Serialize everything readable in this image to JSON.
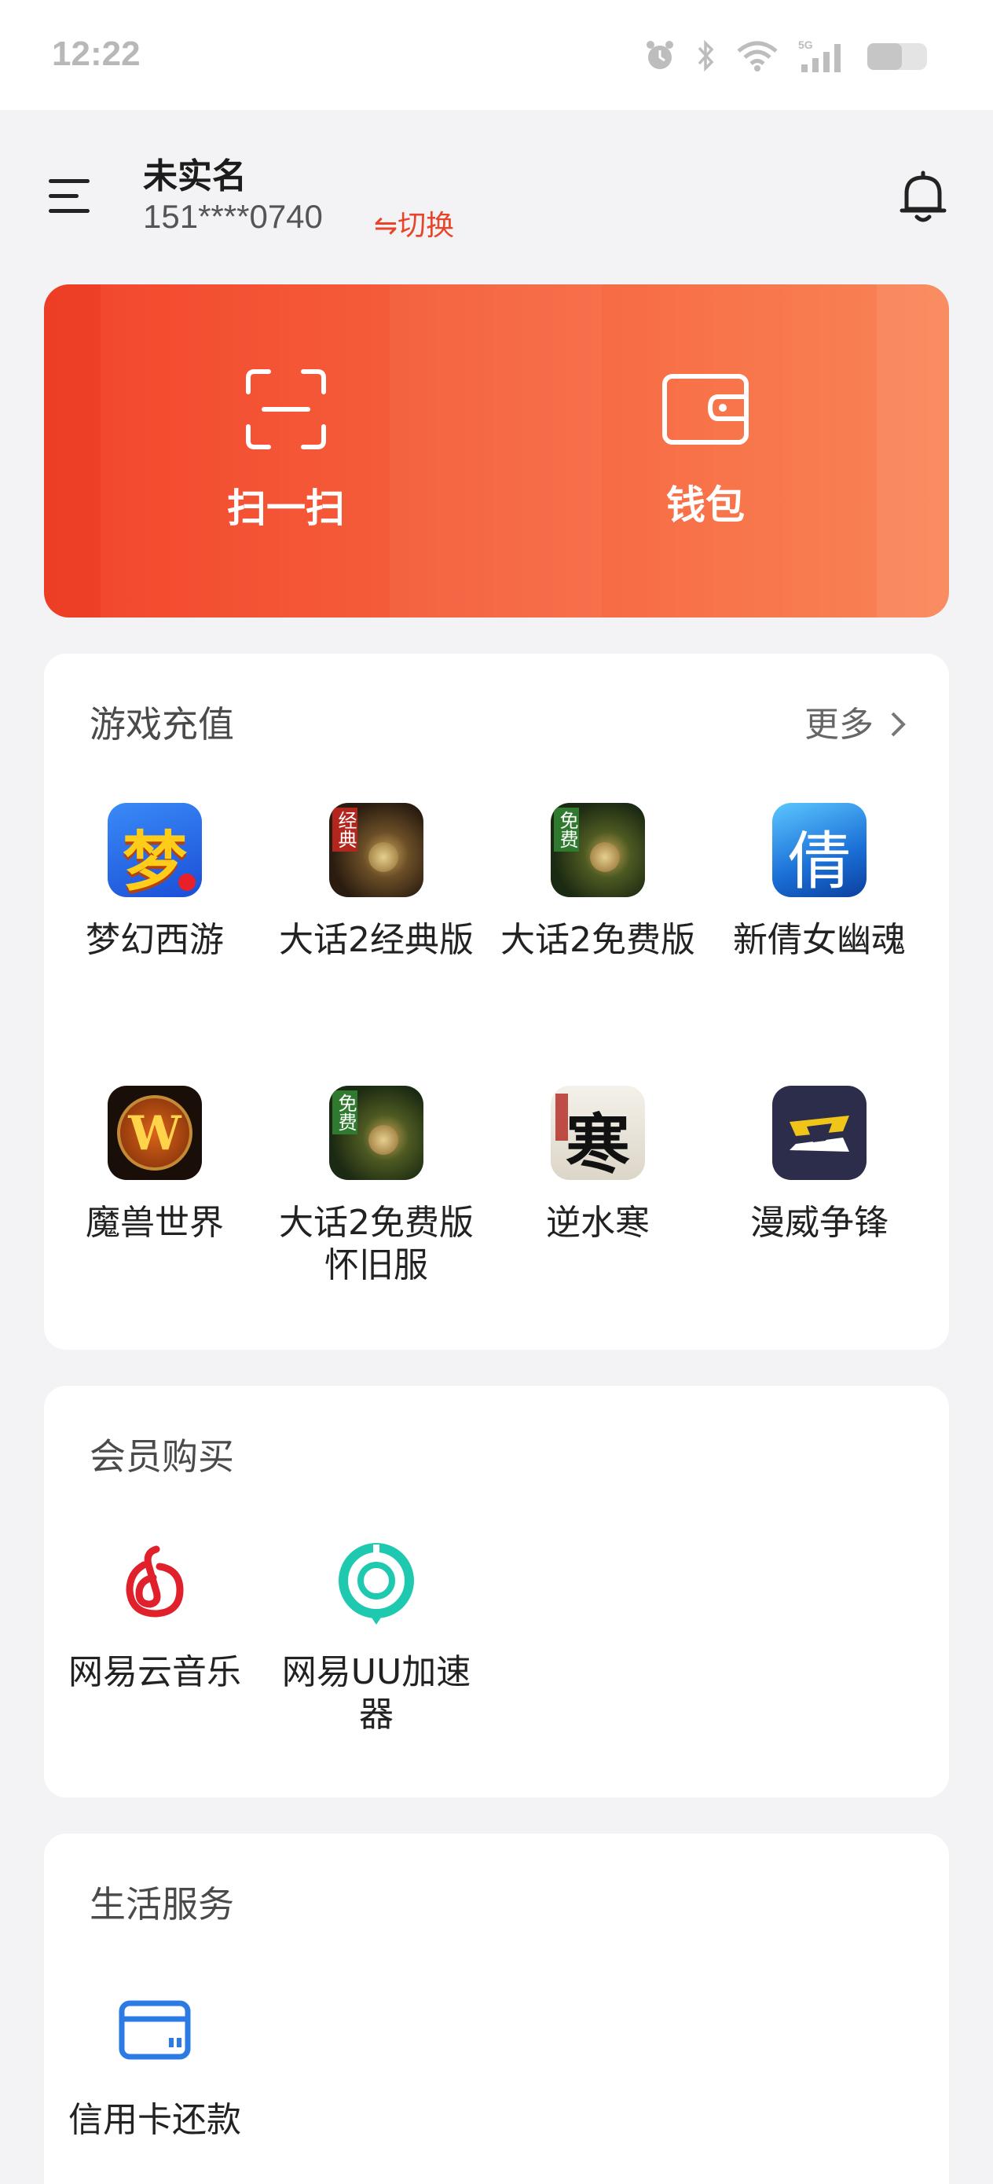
{
  "status_bar": {
    "time": "12:22"
  },
  "header": {
    "user_name": "未实名",
    "phone": "151****0740",
    "switch_label": "⇋切换"
  },
  "hero": {
    "scan_label": "扫一扫",
    "wallet_label": "钱包"
  },
  "game_recharge": {
    "title": "游戏充值",
    "more_label": "更多",
    "items": [
      {
        "label": "梦幻西游",
        "icon": "menghuan-xiyou-icon"
      },
      {
        "label": "大话2经典版",
        "icon": "dahua2-classic-icon",
        "icon_tag": "经典"
      },
      {
        "label": "大话2免费版",
        "icon": "dahua2-free-icon",
        "icon_tag": "免费"
      },
      {
        "label": "新倩女幽魂",
        "icon": "qiannv-icon",
        "icon_tag": "倩"
      },
      {
        "label": "魔兽世界",
        "icon": "warcraft-icon",
        "icon_tag": "W"
      },
      {
        "label": "大话2免费版怀旧服",
        "icon": "dahua2-nostalgia-icon",
        "icon_tag": "免费"
      },
      {
        "label": "逆水寒",
        "icon": "nishuihan-icon",
        "icon_tag": "寒"
      },
      {
        "label": "漫威争锋",
        "icon": "marvel-rivals-icon"
      }
    ]
  },
  "membership": {
    "title": "会员购买",
    "items": [
      {
        "label": "网易云音乐",
        "icon": "netease-music-icon"
      },
      {
        "label": "网易UU加速器",
        "icon": "uu-accelerator-icon"
      }
    ]
  },
  "life_services": {
    "title": "生活服务",
    "items": [
      {
        "label": "信用卡还款",
        "icon": "credit-card-icon"
      }
    ]
  },
  "colors": {
    "accent": "#f2452c",
    "hero_gradient_end": "#f98557",
    "link": "#e8442a",
    "card_bg": "#ffffff",
    "page_bg": "#f3f3f5",
    "music_red": "#e0202b",
    "uu_teal": "#1fc9b0",
    "card_blue": "#2c7be5"
  }
}
